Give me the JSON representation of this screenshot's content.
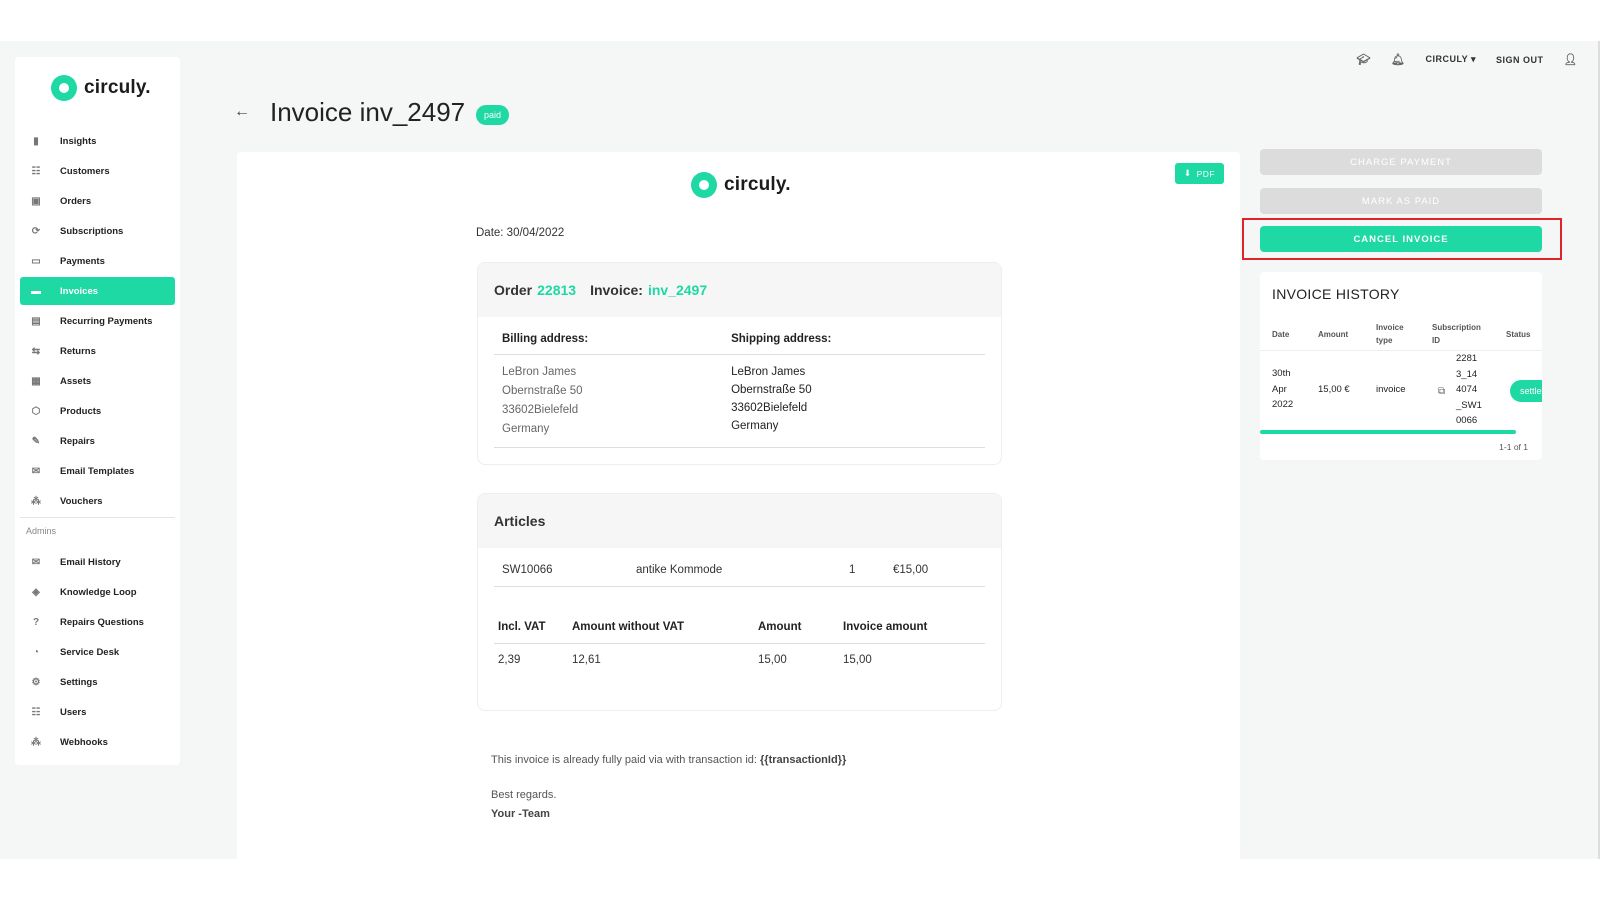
{
  "topbar": {
    "org": "CIRCULY",
    "org_caret": "▾",
    "signout": "SIGN OUT"
  },
  "brand": {
    "name": "circuly.",
    "color": "#1ed9a4"
  },
  "sidebar": {
    "items": [
      {
        "label": "Insights",
        "icon": "chart-icon",
        "glyph": "▮"
      },
      {
        "label": "Customers",
        "icon": "customers-icon",
        "glyph": "☷"
      },
      {
        "label": "Orders",
        "icon": "orders-icon",
        "glyph": "▣"
      },
      {
        "label": "Subscriptions",
        "icon": "subscriptions-icon",
        "glyph": "⟳"
      },
      {
        "label": "Payments",
        "icon": "payments-icon",
        "glyph": "▭"
      },
      {
        "label": "Invoices",
        "icon": "invoices-icon",
        "glyph": "▬",
        "active": true
      },
      {
        "label": "Recurring Payments",
        "icon": "recurring-payments-icon",
        "glyph": "▤"
      },
      {
        "label": "Returns",
        "icon": "returns-icon",
        "glyph": "⇆"
      },
      {
        "label": "Assets",
        "icon": "assets-icon",
        "glyph": "▦"
      },
      {
        "label": "Products",
        "icon": "products-icon",
        "glyph": "⬡"
      },
      {
        "label": "Repairs",
        "icon": "wrench-icon",
        "glyph": "✎"
      },
      {
        "label": "Email Templates",
        "icon": "mail-icon",
        "glyph": "✉"
      },
      {
        "label": "Vouchers",
        "icon": "vouchers-icon",
        "glyph": "⁂"
      }
    ],
    "admin_section": "Admins",
    "admin_items": [
      {
        "label": "Email History",
        "icon": "mail-history-icon",
        "glyph": "✉"
      },
      {
        "label": "Knowledge Loop",
        "icon": "graduation-icon",
        "glyph": "◈"
      },
      {
        "label": "Repairs Questions",
        "icon": "question-icon",
        "glyph": "?"
      },
      {
        "label": "Service Desk",
        "icon": "service-desk-icon",
        "glyph": "◔"
      },
      {
        "label": "Settings",
        "icon": "gear-icon",
        "glyph": "⚙"
      },
      {
        "label": "Users",
        "icon": "users-icon",
        "glyph": "☷"
      },
      {
        "label": "Webhooks",
        "icon": "webhooks-icon",
        "glyph": "⁂"
      }
    ]
  },
  "header": {
    "back": "←",
    "title": "Invoice inv_2497",
    "status": "paid"
  },
  "invoice": {
    "pdf_label": "PDF",
    "date": "Date: 30/04/2022",
    "order_label": "Order",
    "order_number": "22813",
    "invoice_label": "Invoice:",
    "invoice_number": "inv_2497",
    "billing_title": "Billing address:",
    "shipping_title": "Shipping address:",
    "billing": [
      "LeBron James",
      "Obernstraße 50",
      "33602Bielefeld",
      "Germany"
    ],
    "shipping": [
      "LeBron James",
      "Obernstraße 50",
      "33602Bielefeld",
      "Germany"
    ],
    "articles_title": "Articles",
    "article": {
      "sku": "SW10066",
      "name": "antike Kommode",
      "qty": "1",
      "price": "€15,00"
    },
    "vat_headers": [
      "Incl. VAT",
      "Amount without VAT",
      "Amount",
      "Invoice amount"
    ],
    "vat_values": [
      "2,39",
      "12,61",
      "15,00",
      "15,00"
    ],
    "note_text": "This invoice is already fully paid via with transaction id:",
    "note_var": "{{transactionId}}",
    "regards": "Best regards.",
    "team": "Your -Team"
  },
  "actions": {
    "charge": "CHARGE PAYMENT",
    "mark_paid": "MARK AS PAID",
    "cancel": "CANCEL INVOICE"
  },
  "history": {
    "title": "INVOICE HISTORY",
    "columns": [
      "Date",
      "Amount",
      "Invoice\ntype",
      "Subscription\nID",
      "Status"
    ],
    "row": {
      "date": "30th\nApr\n2022",
      "amount": "15,00 €",
      "type": "invoice",
      "subscription_id": "2281\n3_14\n4074\n_SW1\n0066",
      "status": "settled"
    },
    "pager": "1-1 of 1"
  }
}
